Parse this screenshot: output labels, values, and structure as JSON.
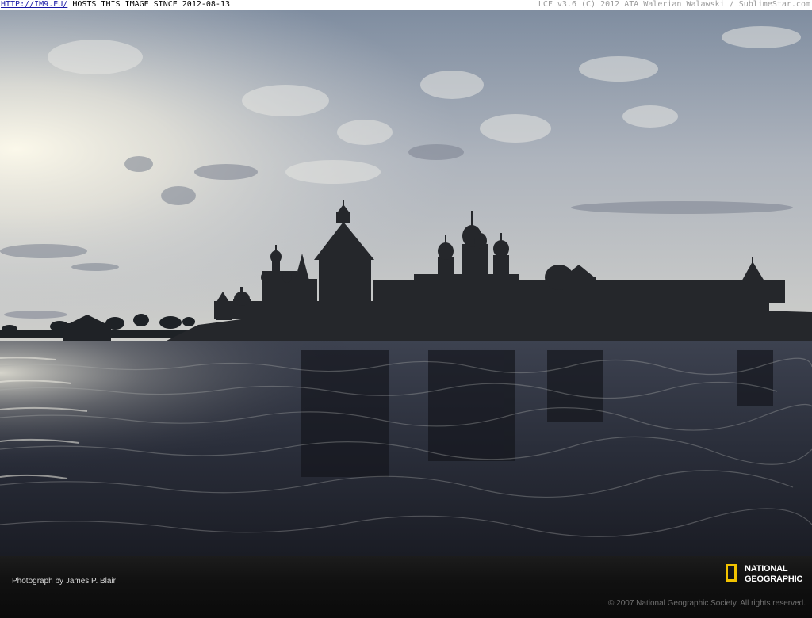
{
  "header": {
    "link_text": "HTTP://IM9.EU/",
    "hosts_text": " HOSTS THIS IMAGE SINCE 2012-08-13",
    "right_text": "LCF v3.6 (C) 2012 ATA Walerian Walawski / SublimeStar.com"
  },
  "footer": {
    "credit": "Photograph by James P. Blair",
    "logo_line1": "NATIONAL",
    "logo_line2": "GEOGRAPHIC",
    "copyright": "© 2007 National Geographic Society. All rights reserved."
  },
  "colors": {
    "sky_top": "#7f8da0",
    "sky_glow": "#f2f0e6",
    "water": "#2a2e3a",
    "logo_yellow": "#f2c300"
  }
}
